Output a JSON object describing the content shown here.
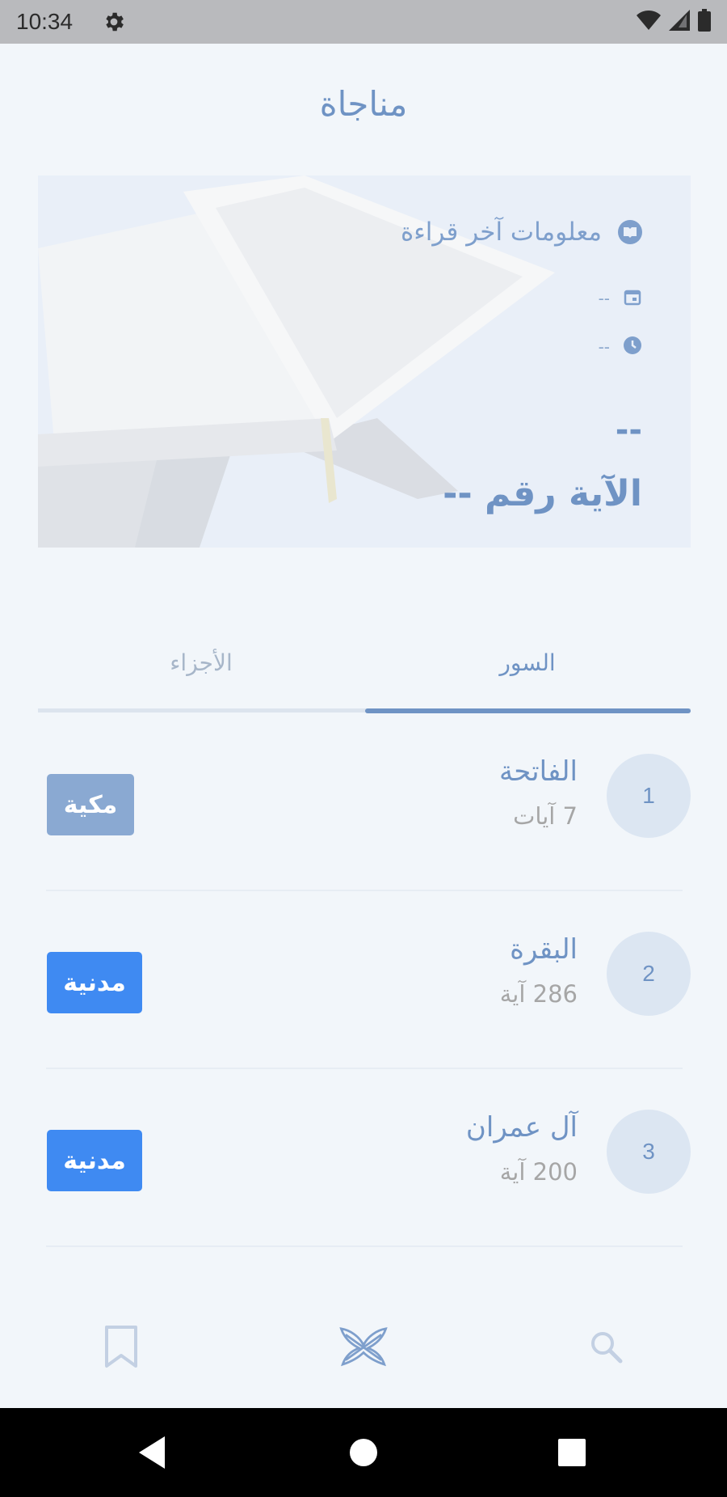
{
  "status_bar": {
    "time": "10:34"
  },
  "app": {
    "title": "مناجاة"
  },
  "last_reading": {
    "header": "معلومات آخر قراءة",
    "date": "--",
    "time": "--",
    "surah_placeholder": "--",
    "ayah": "الآية رقم --"
  },
  "tabs": [
    {
      "label": "الأجزاء",
      "selected": false
    },
    {
      "label": "السور",
      "selected": true
    }
  ],
  "surahs": [
    {
      "number": "1",
      "name": "الفاتحة",
      "ayah_count": "7 آيات",
      "type": "مكية",
      "type_color": "#8aa9d2"
    },
    {
      "number": "2",
      "name": "البقرة",
      "ayah_count": "286 آية",
      "type": "مدنية",
      "type_color": "#3f8af2"
    },
    {
      "number": "3",
      "name": "آل عمران",
      "ayah_count": "200 آية",
      "type": "مدنية",
      "type_color": "#3f8af2"
    }
  ],
  "bottom_nav": {
    "items": [
      "bookmark-icon",
      "quran-icon",
      "search-icon"
    ],
    "active": "quran-icon"
  },
  "colors": {
    "accent": "#6f93c4",
    "background": "#f2f6fa"
  }
}
